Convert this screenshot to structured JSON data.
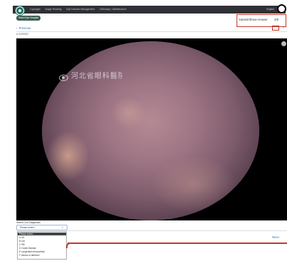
{
  "nav": {
    "items": [
      "Copyright",
      "Image Reading",
      "Eye Disease Management",
      "Dictionary / Maintenance"
    ],
    "language": "English"
  },
  "badge": "Hebei Eye Hospital",
  "toolbar": {
    "previous_label": "Previous",
    "submit_label": "Submit/Show Answer",
    "counter": "2/8",
    "next_label": "Next"
  },
  "image": {
    "id": "# 0190002",
    "watermark": "河北省眼科醫院"
  },
  "diagnosis": {
    "label": "Select Our Diagnosis",
    "placeholder": "Please select...",
    "options": [
      "Please select...",
      "A 4D",
      "B cun",
      "C RB",
      "D Coats Disease",
      "E congenital retinoschisis",
      "F fundus of albinism"
    ]
  },
  "colors": {
    "accent_red": "#c0392b",
    "link_blue": "#2a73b8",
    "nav_bg": "#2f3136",
    "badge_bg": "#3d5e52"
  }
}
